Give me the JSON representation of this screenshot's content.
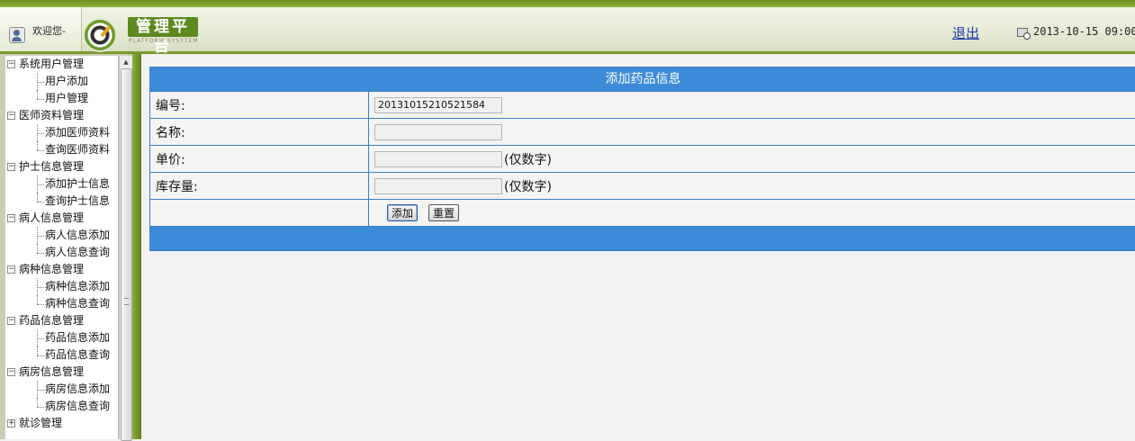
{
  "header": {
    "welcome": "欢迎您-",
    "brand": "管理平台",
    "brand_sub": "PLATFORM SYSYTEM",
    "logout": "退出",
    "datetime": "2013-10-15 09:00:"
  },
  "sidebar": {
    "groups": [
      {
        "label": "系统用户管理",
        "expanded": true,
        "items": [
          "用户添加",
          "用户管理"
        ]
      },
      {
        "label": "医师资料管理",
        "expanded": true,
        "items": [
          "添加医师资料",
          "查询医师资料"
        ]
      },
      {
        "label": "护士信息管理",
        "expanded": true,
        "items": [
          "添加护士信息",
          "查询护士信息"
        ]
      },
      {
        "label": "病人信息管理",
        "expanded": true,
        "items": [
          "病人信息添加",
          "病人信息查询"
        ]
      },
      {
        "label": "病种信息管理",
        "expanded": true,
        "items": [
          "病种信息添加",
          "病种信息查询"
        ]
      },
      {
        "label": "药品信息管理",
        "expanded": true,
        "items": [
          "药品信息添加",
          "药品信息查询"
        ]
      },
      {
        "label": "病房信息管理",
        "expanded": true,
        "items": [
          "病房信息添加",
          "病房信息查询"
        ]
      },
      {
        "label": "就诊管理",
        "expanded": false,
        "items": []
      }
    ]
  },
  "form": {
    "title": "添加药品信息",
    "rows": [
      {
        "label": "编号:",
        "value": "20131015210521584",
        "hint": ""
      },
      {
        "label": "名称:",
        "value": "",
        "hint": ""
      },
      {
        "label": "单价:",
        "value": "",
        "hint": "(仅数字)"
      },
      {
        "label": "库存量:",
        "value": "",
        "hint": "(仅数字)"
      }
    ],
    "add_button": "添加",
    "reset_button": "重置"
  },
  "colors": {
    "accent_green": "#7a9a2e",
    "form_blue": "#3d8bd8",
    "link_blue": "#1b3fa8"
  }
}
